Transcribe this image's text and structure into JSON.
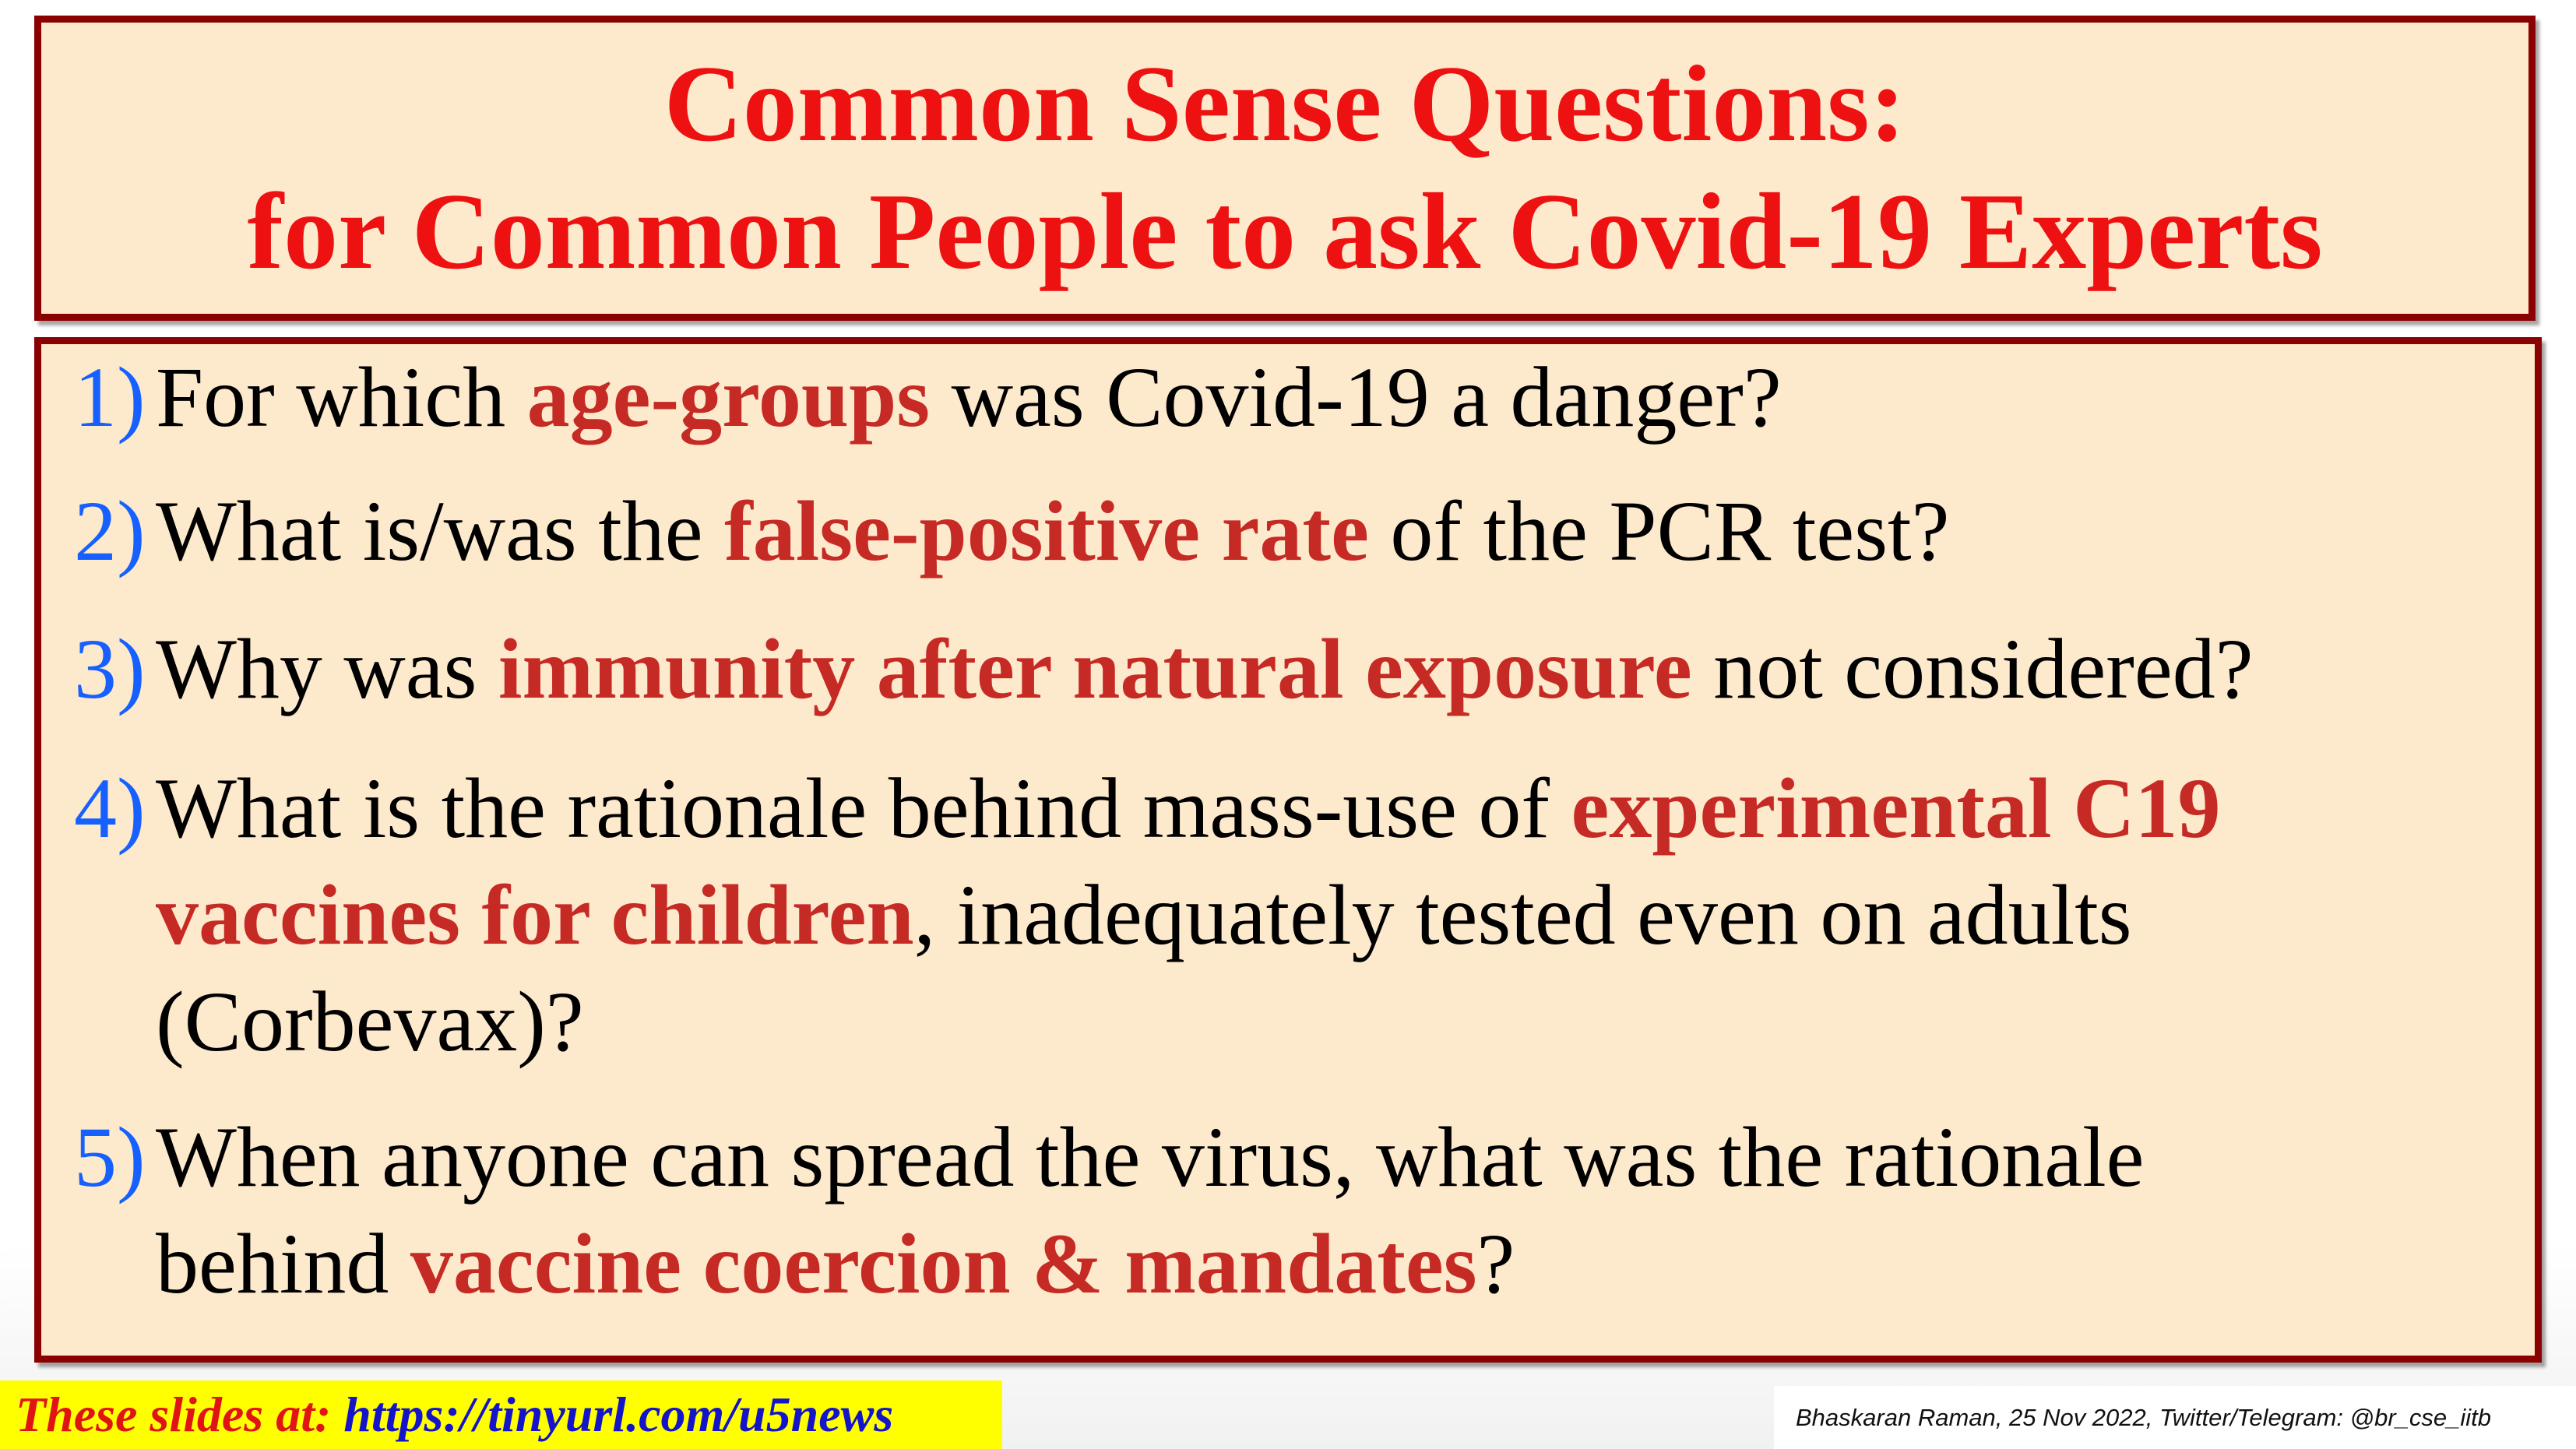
{
  "title": {
    "line1": "Common Sense Questions:",
    "line2": "for Common People to ask Covid-19 Experts"
  },
  "questions": [
    {
      "number": "1)",
      "parts": [
        "For which ",
        "age-groups",
        " was Covid-19 a danger?"
      ]
    },
    {
      "number": "2)",
      "parts": [
        "What is/was the ",
        "false-positive rate",
        " of the PCR test?"
      ]
    },
    {
      "number": "3)",
      "parts": [
        "Why was ",
        "immunity after natural exposure",
        " not considered?"
      ]
    },
    {
      "number": "4)",
      "parts": [
        "What is the rationale behind mass-use of ",
        "experimental C19",
        "vaccines for children",
        ", inadequately tested even on adults",
        "(Corbevax)?"
      ]
    },
    {
      "number": "5)",
      "parts": [
        "When anyone can spread the virus, what was the rationale",
        "behind ",
        "vaccine coercion & mandates",
        "?"
      ]
    }
  ],
  "footer": {
    "link_label": "These slides at: ",
    "link_url": "https://tinyurl.com/u5news",
    "credit": "Bhaskaran Raman, 25 Nov 2022, Twitter/Telegram: @br_cse_iitb"
  },
  "colors": {
    "title_red": "#ee1111",
    "highlight_red": "#c62a24",
    "number_blue": "#1560ff",
    "border": "#8b0000",
    "panel_bg": "#fde9cc",
    "footer_yellow": "#ffff00"
  }
}
